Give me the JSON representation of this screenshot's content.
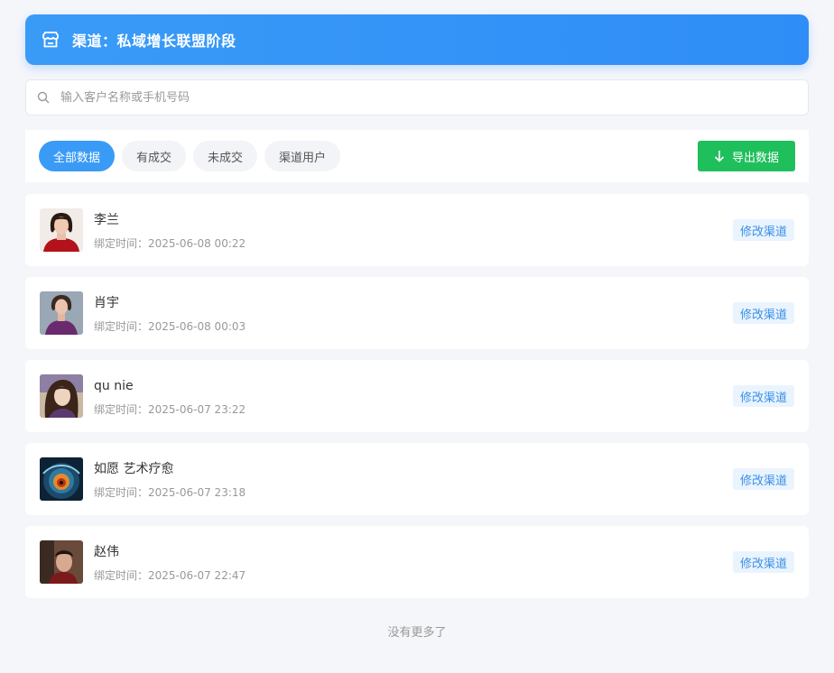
{
  "header": {
    "title": "渠道：私域增长联盟阶段",
    "icon": "shop-icon",
    "bg_color": "#3a9bf7"
  },
  "search": {
    "placeholder": "输入客户名称或手机号码",
    "value": ""
  },
  "filters": {
    "tabs": [
      {
        "label": "全部数据",
        "active": true
      },
      {
        "label": "有成交",
        "active": false
      },
      {
        "label": "未成交",
        "active": false
      },
      {
        "label": "渠道用户",
        "active": false
      }
    ],
    "export_label": "导出数据",
    "export_color": "#1fbf5b"
  },
  "customers": [
    {
      "name": "李兰",
      "bind_time": "绑定时间：2025-06-08 00:22",
      "action": "修改渠道",
      "avatar": "woman-red-sweater"
    },
    {
      "name": "肖宇",
      "bind_time": "绑定时间：2025-06-08 00:03",
      "action": "修改渠道",
      "avatar": "woman-purple-dress"
    },
    {
      "name": "qu  nie",
      "bind_time": "绑定时间：2025-06-07 23:22",
      "action": "修改渠道",
      "avatar": "woman-portrait"
    },
    {
      "name": "如愿 艺术疗愈",
      "bind_time": "绑定时间：2025-06-07 23:18",
      "action": "修改渠道",
      "avatar": "vortex-art"
    },
    {
      "name": "赵伟",
      "bind_time": "绑定时间：2025-06-07 22:47",
      "action": "修改渠道",
      "avatar": "man-portrait"
    }
  ],
  "footer": {
    "text": "没有更多了"
  }
}
